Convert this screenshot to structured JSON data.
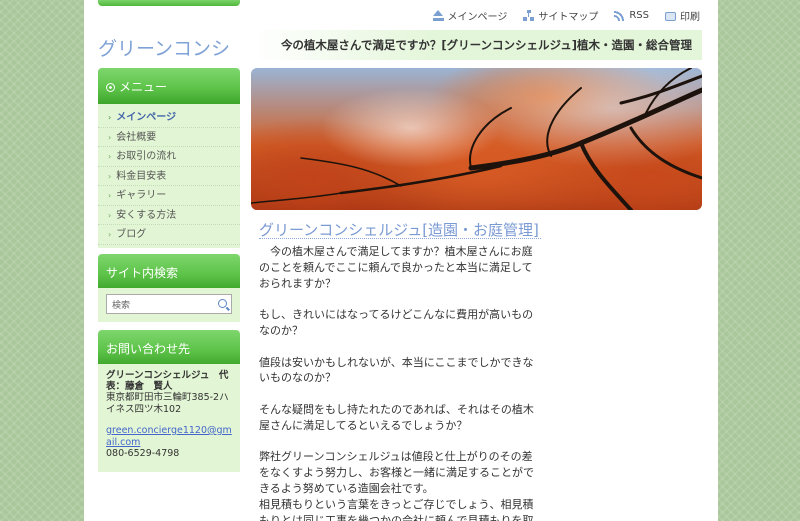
{
  "site": {
    "name": "グリーンコンシ"
  },
  "top_nav": [
    {
      "label": "メインページ",
      "icon": "home-icon"
    },
    {
      "label": "サイトマップ",
      "icon": "sitemap-icon"
    },
    {
      "label": "RSS",
      "icon": "rss-icon"
    },
    {
      "label": "印刷",
      "icon": "print-icon"
    }
  ],
  "headline": "今の植木屋さんで満足ですか？[グリーンコンシェルジュ]植木・造園・総合管理",
  "menu": {
    "title": "メニュー",
    "items": [
      {
        "label": "メインページ",
        "active": true
      },
      {
        "label": "会社概要"
      },
      {
        "label": "お取引の流れ"
      },
      {
        "label": "料金目安表"
      },
      {
        "label": "ギャラリー"
      },
      {
        "label": "安くする方法"
      },
      {
        "label": "ブログ"
      }
    ]
  },
  "search": {
    "title": "サイト内検索",
    "placeholder": "検索"
  },
  "contact": {
    "title": "お問い合わせ先",
    "name": "グリーンコンシェルジュ　代表：藤倉　賢人",
    "address": "東京都町田市三輪町385-2ハイネス四ツ木102",
    "email": "green.concierge1120@gmail.com",
    "phone": "080-6529-4798"
  },
  "main": {
    "title": "グリーンコンシェルジュ[造園・お庭管理]",
    "paragraphs": [
      "　今の植木屋さんで満足してますか？植木屋さんにお庭のことを頼んでここに頼んで良かったと本当に満足しておられますか？",
      "もし、きれいにはなってるけどこんなに費用が高いものなのか？",
      "値段は安いかもしれないが、本当にここまでしかできないものなのか？",
      "そんな疑問をもし持たれたのであれば、それはその植木屋さんに満足してるといえるでしょうか？",
      "弊社グリーンコンシェルジュは値段と仕上がりのその差をなくすよう努力し、お客様と一緒に満足することができるよう努めている造園会社です。",
      "相見積もりという言葉をきっとご存じでしょう、相見積もりとは同じ工事を幾つかの会社に頼んで見積もりを取ることです。"
    ]
  },
  "colors": {
    "accent_green": "#5ec44a",
    "sidebar_bg": "#e2f5d4",
    "title_blue": "#7a9ad4",
    "link_blue": "#4466cc",
    "page_bg": "#a9c79a"
  }
}
